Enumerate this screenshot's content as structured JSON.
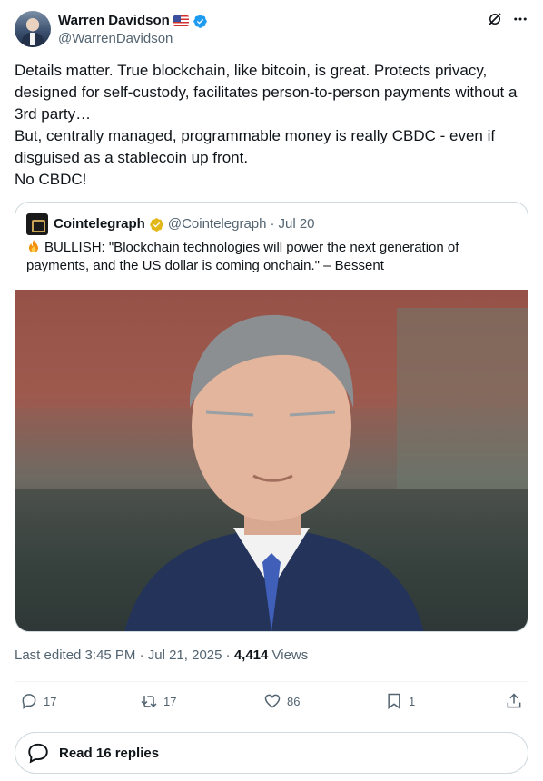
{
  "author": {
    "display_name": "Warren Davidson",
    "handle": "@WarrenDavidson",
    "flag_icon": "us-flag-icon",
    "verified_color": "#1d9bf0"
  },
  "tweet": {
    "text": "Details matter. True blockchain, like bitcoin, is great. Protects privacy, designed for self-custody, facilitates person-to-person payments without a 3rd party…\nBut, centrally managed, programmable money is really CBDC - even if disguised as a stablecoin up front.\nNo CBDC!"
  },
  "quote": {
    "display_name": "Cointelegraph",
    "handle": "@Cointelegraph",
    "separator": "·",
    "date": "Jul 20",
    "verified_color": "#e2b719",
    "text": "BULLISH: \"Blockchain technologies will power the next generation of payments, and the US dollar is coming onchain.\" – Bessent"
  },
  "meta": {
    "edited": "Last edited 3:45 PM · Jul 21, 2025 · ",
    "views_count": "4,414",
    "views_label": " Views"
  },
  "actions": {
    "replies": "17",
    "reposts": "17",
    "likes": "86",
    "bookmarks": "1"
  },
  "read_replies": "Read 16 replies"
}
